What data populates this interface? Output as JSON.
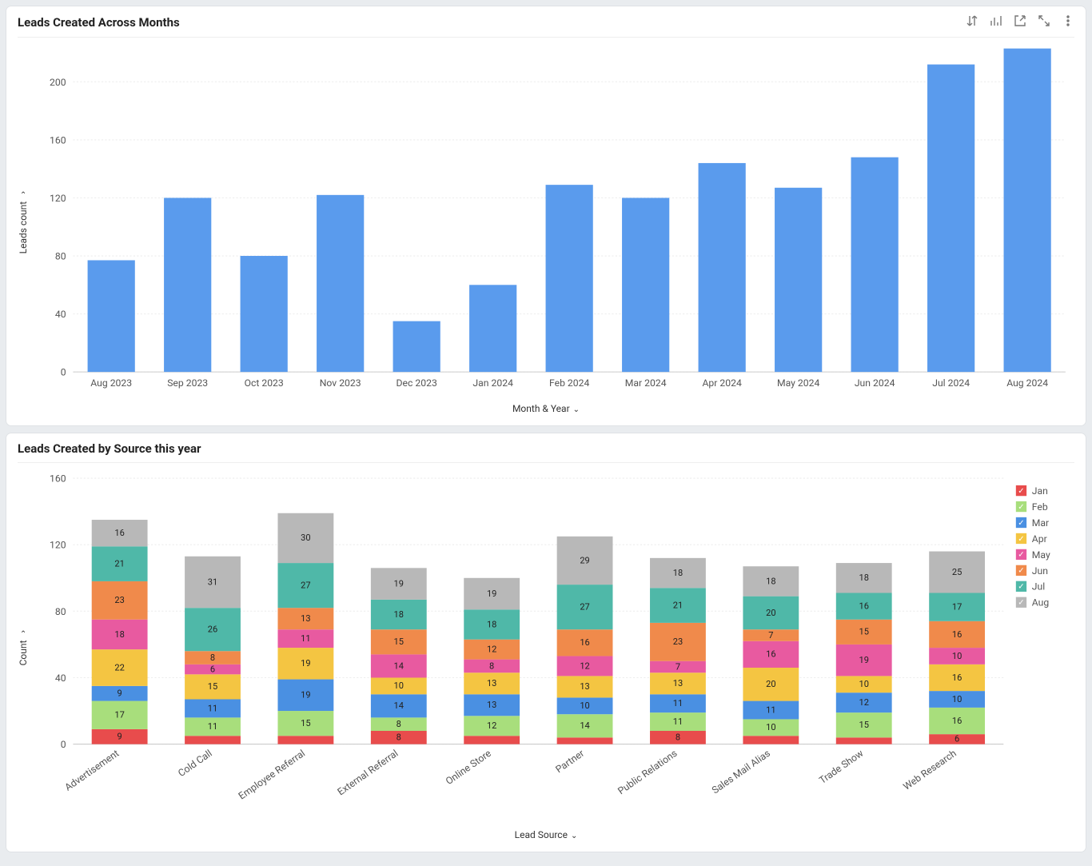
{
  "chart1": {
    "title": "Leads Created Across Months",
    "ylabel": "Leads count",
    "xlabel": "Month & Year"
  },
  "chart2": {
    "title": "Leads Created by Source this year",
    "ylabel": "Count",
    "xlabel": "Lead Source"
  },
  "chart_data": [
    {
      "type": "bar",
      "title": "Leads Created Across Months",
      "xlabel": "Month & Year",
      "ylabel": "Leads count",
      "ylim": [
        0,
        220
      ],
      "yticks": [
        0,
        40,
        80,
        120,
        160,
        200
      ],
      "categories": [
        "Aug 2023",
        "Sep 2023",
        "Oct 2023",
        "Nov 2023",
        "Dec 2023",
        "Jan 2024",
        "Feb 2024",
        "Mar 2024",
        "Apr 2024",
        "May 2024",
        "Jun 2024",
        "Jul 2024",
        "Aug 2024"
      ],
      "values": [
        77,
        120,
        80,
        122,
        35,
        60,
        129,
        120,
        144,
        127,
        148,
        212,
        223
      ],
      "bar_color": "#5a9bed"
    },
    {
      "type": "bar",
      "stacked": true,
      "title": "Leads Created by Source this year",
      "xlabel": "Lead Source",
      "ylabel": "Count",
      "ylim": [
        0,
        160
      ],
      "yticks": [
        0,
        40,
        80,
        120,
        160
      ],
      "categories": [
        "Advertisement",
        "Cold Call",
        "Employee Referral",
        "External Referral",
        "Online Store",
        "Partner",
        "Public Relations",
        "Sales Mail Alias",
        "Trade Show",
        "Web Research"
      ],
      "series": [
        {
          "name": "Jan",
          "color": "#e84c4c",
          "values": [
            9,
            5,
            5,
            8,
            5,
            4,
            8,
            5,
            4,
            6
          ]
        },
        {
          "name": "Feb",
          "color": "#a8de7c",
          "values": [
            17,
            11,
            15,
            8,
            12,
            14,
            11,
            10,
            15,
            16
          ]
        },
        {
          "name": "Mar",
          "color": "#4a90e2",
          "values": [
            9,
            11,
            19,
            14,
            13,
            10,
            11,
            11,
            12,
            10
          ]
        },
        {
          "name": "Apr",
          "color": "#f4c542",
          "values": [
            22,
            15,
            19,
            10,
            13,
            13,
            13,
            20,
            10,
            16
          ]
        },
        {
          "name": "May",
          "color": "#e85aa0",
          "values": [
            18,
            6,
            11,
            14,
            8,
            12,
            7,
            16,
            19,
            10
          ]
        },
        {
          "name": "Jun",
          "color": "#f08a4b",
          "values": [
            23,
            8,
            13,
            15,
            12,
            16,
            23,
            7,
            15,
            16
          ]
        },
        {
          "name": "Jul",
          "color": "#4fb8a8",
          "values": [
            21,
            26,
            27,
            18,
            18,
            27,
            21,
            20,
            16,
            17
          ]
        },
        {
          "name": "Aug",
          "color": "#b8b8b8",
          "values": [
            16,
            31,
            30,
            19,
            19,
            29,
            18,
            18,
            18,
            25
          ]
        }
      ],
      "legend_position": "right"
    }
  ]
}
